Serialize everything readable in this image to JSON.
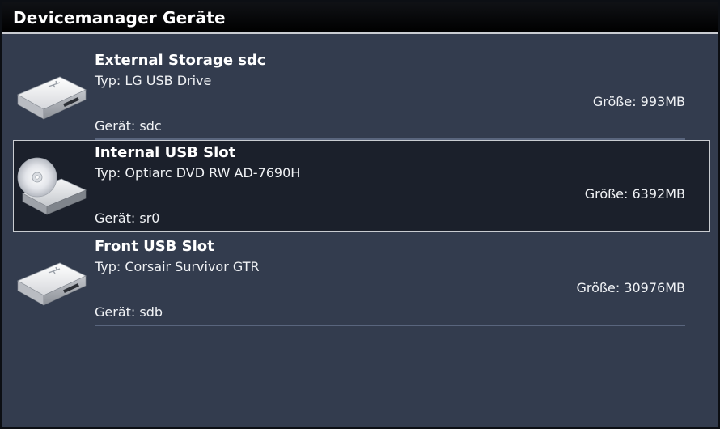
{
  "window": {
    "title": "Devicemanager Geräte"
  },
  "devices": [
    {
      "name": "External Storage sdc",
      "type": "Typ: LG  USB Drive",
      "size": "Größe: 993MB",
      "device": "Gerät: sdc",
      "icon": "usb-drive-icon",
      "selected": false
    },
    {
      "name": "Internal USB Slot",
      "type": "Typ: Optiarc  DVD RW AD-7690H",
      "size": "Größe: 6392MB",
      "device": "Gerät: sr0",
      "icon": "optical-drive-icon",
      "selected": true
    },
    {
      "name": "Front USB Slot",
      "type": "Typ: Corsair  Survivor GTR",
      "size": "Größe: 30976MB",
      "device": "Gerät: sdb",
      "icon": "usb-drive-icon",
      "selected": false
    }
  ]
}
